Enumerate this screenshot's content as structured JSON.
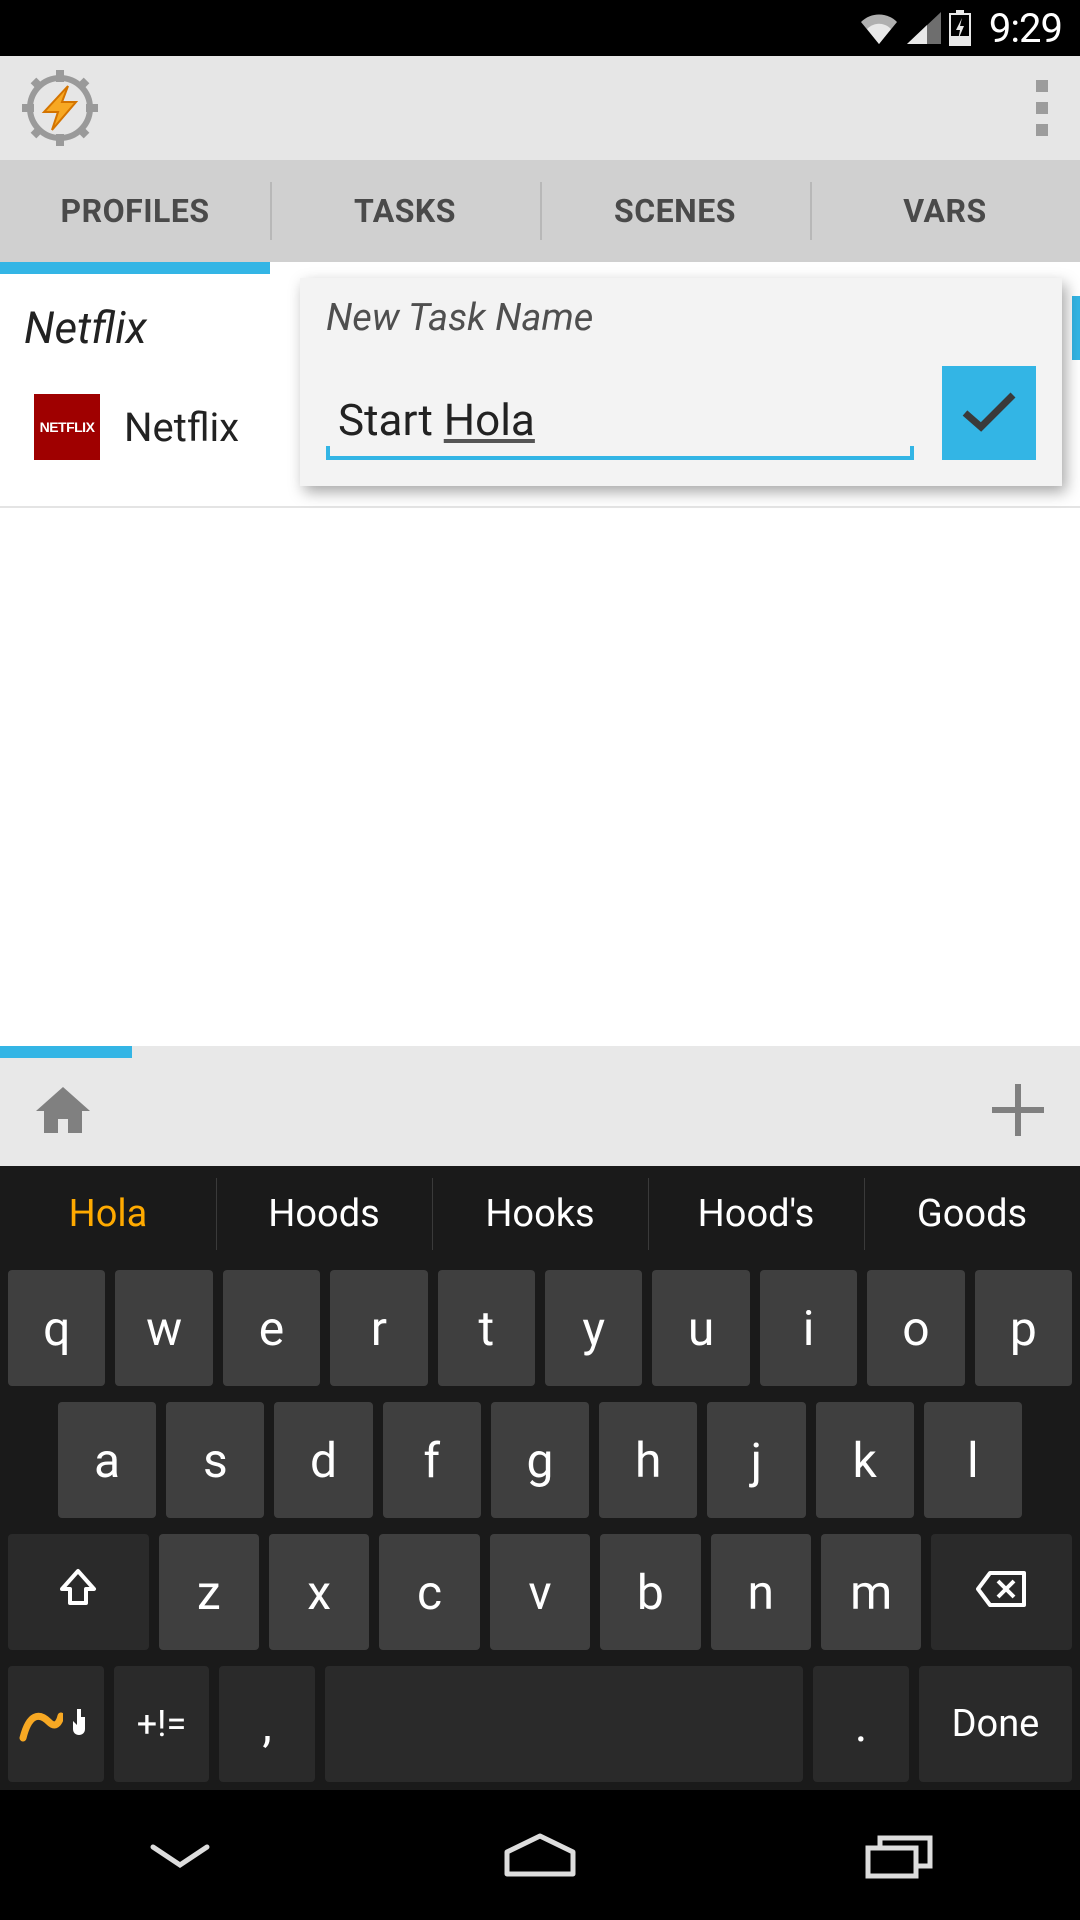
{
  "statusbar": {
    "time": "9:29"
  },
  "tabs": [
    "PROFILES",
    "TASKS",
    "SCENES",
    "VARS"
  ],
  "active_tab_index": 0,
  "profile": {
    "name": "Netflix",
    "app_label": "Netflix",
    "app_icon_text": "NETFLIX"
  },
  "dialog": {
    "title": "New Task Name",
    "input_prefix": "Start ",
    "input_active_word": "Hola"
  },
  "keyboard": {
    "suggestions": [
      "Hola",
      "Hoods",
      "Hooks",
      "Hood's",
      "Goods"
    ],
    "row1": [
      "q",
      "w",
      "e",
      "r",
      "t",
      "y",
      "u",
      "i",
      "o",
      "p"
    ],
    "row2": [
      "a",
      "s",
      "d",
      "f",
      "g",
      "h",
      "j",
      "k",
      "l"
    ],
    "row3": [
      "z",
      "x",
      "c",
      "v",
      "b",
      "n",
      "m"
    ],
    "symbols_key": "+!=",
    "comma_key": ",",
    "period_key": ".",
    "done_key": "Done"
  }
}
